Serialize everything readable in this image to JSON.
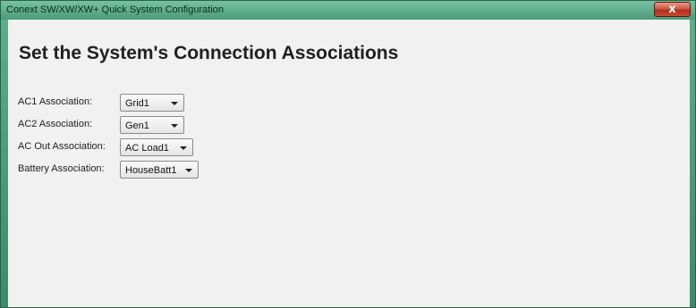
{
  "window": {
    "title": "Conext SW/XW/XW+ Quick System Configuration",
    "close_label": "x"
  },
  "heading": "Set the System's Connection Associations",
  "associations": [
    {
      "label": "AC1 Association:",
      "value": "Grid1"
    },
    {
      "label": "AC2 Association:",
      "value": "Gen1"
    },
    {
      "label": "AC Out Association:",
      "value": "AC Load1"
    },
    {
      "label": "Battery Association:",
      "value": "HouseBatt1"
    }
  ],
  "colors": {
    "title_bar": "#5fae8d",
    "close_button": "#c84a33",
    "client_background": "#f1f1f1"
  }
}
